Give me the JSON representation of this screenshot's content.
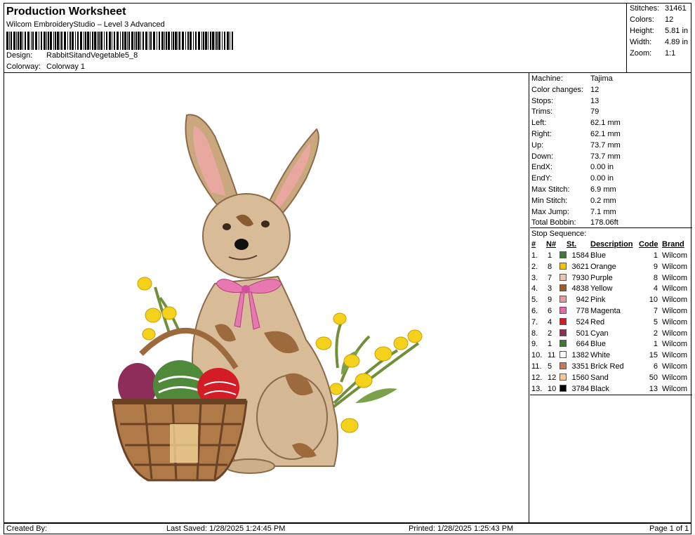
{
  "header": {
    "title": "Production Worksheet",
    "subtitle": "Wilcom EmbroideryStudio – Level 3 Advanced",
    "design_label": "Design:",
    "design_value": "RabbitSitandVegetable5_8",
    "colorway_label": "Colorway:",
    "colorway_value": "Colorway 1"
  },
  "stats": [
    {
      "label": "Stitches:",
      "value": "31461"
    },
    {
      "label": "Colors:",
      "value": "12"
    },
    {
      "label": "Height:",
      "value": "5.81 in"
    },
    {
      "label": "Width:",
      "value": "4.89 in"
    },
    {
      "label": "Zoom:",
      "value": "1:1"
    }
  ],
  "machine_info": [
    {
      "label": "Machine:",
      "value": "Tajima"
    },
    {
      "label": "Color changes:",
      "value": "12"
    },
    {
      "label": "Stops:",
      "value": "13"
    },
    {
      "label": "Trims:",
      "value": "79"
    },
    {
      "label": "Left:",
      "value": "62.1 mm"
    },
    {
      "label": "Right:",
      "value": "62.1 mm"
    },
    {
      "label": "Up:",
      "value": "73.7 mm"
    },
    {
      "label": "Down:",
      "value": "73.7 mm"
    },
    {
      "label": "EndX:",
      "value": "0.00 in"
    },
    {
      "label": "EndY:",
      "value": "0.00 in"
    },
    {
      "label": "Max Stitch:",
      "value": "6.9 mm"
    },
    {
      "label": "Min Stitch:",
      "value": "0.2 mm"
    },
    {
      "label": "Max Jump:",
      "value": "7.1 mm"
    },
    {
      "label": "Total Bobbin:",
      "value": "178.06ft"
    }
  ],
  "stop_sequence": {
    "title": "Stop Sequence:",
    "headers": {
      "num": "#",
      "n": "N#",
      "st": "St.",
      "desc": "Description",
      "code": "Code",
      "brand": "Brand"
    },
    "rows": [
      {
        "num": "1.",
        "n": "1",
        "color": "#3f7a32",
        "st": "1584",
        "desc": "Blue",
        "code": "1",
        "brand": "Wilcom"
      },
      {
        "num": "2.",
        "n": "8",
        "color": "#f2c500",
        "st": "3621",
        "desc": "Orange",
        "code": "9",
        "brand": "Wilcom"
      },
      {
        "num": "3.",
        "n": "7",
        "color": "#f0c2b4",
        "st": "7930",
        "desc": "Purple",
        "code": "8",
        "brand": "Wilcom"
      },
      {
        "num": "4.",
        "n": "3",
        "color": "#a0592c",
        "st": "4838",
        "desc": "Yellow",
        "code": "4",
        "brand": "Wilcom"
      },
      {
        "num": "5.",
        "n": "9",
        "color": "#e89aa2",
        "st": "942",
        "desc": "Pink",
        "code": "10",
        "brand": "Wilcom"
      },
      {
        "num": "6.",
        "n": "6",
        "color": "#e868a8",
        "st": "778",
        "desc": "Magenta",
        "code": "7",
        "brand": "Wilcom"
      },
      {
        "num": "7.",
        "n": "4",
        "color": "#d41c26",
        "st": "524",
        "desc": "Red",
        "code": "5",
        "brand": "Wilcom"
      },
      {
        "num": "8.",
        "n": "2",
        "color": "#8e2d5a",
        "st": "501",
        "desc": "Cyan",
        "code": "2",
        "brand": "Wilcom"
      },
      {
        "num": "9.",
        "n": "1",
        "color": "#3f7a32",
        "st": "664",
        "desc": "Blue",
        "code": "1",
        "brand": "Wilcom"
      },
      {
        "num": "10.",
        "n": "11",
        "color": "#ffffff",
        "st": "1382",
        "desc": "White",
        "code": "15",
        "brand": "Wilcom"
      },
      {
        "num": "11.",
        "n": "5",
        "color": "#c47a5a",
        "st": "3351",
        "desc": "Brick Red",
        "code": "6",
        "brand": "Wilcom"
      },
      {
        "num": "12.",
        "n": "12",
        "color": "#f5c896",
        "st": "1560",
        "desc": "Sand",
        "code": "50",
        "brand": "Wilcom"
      },
      {
        "num": "13.",
        "n": "10",
        "color": "#000000",
        "st": "3784",
        "desc": "Black",
        "code": "13",
        "brand": "Wilcom"
      }
    ]
  },
  "footer": {
    "created_by": "Created By:",
    "last_saved": "Last Saved: 1/28/2025 1:24:45 PM",
    "printed": "Printed: 1/28/2025 1:25:43 PM",
    "page": "Page 1 of 1"
  }
}
